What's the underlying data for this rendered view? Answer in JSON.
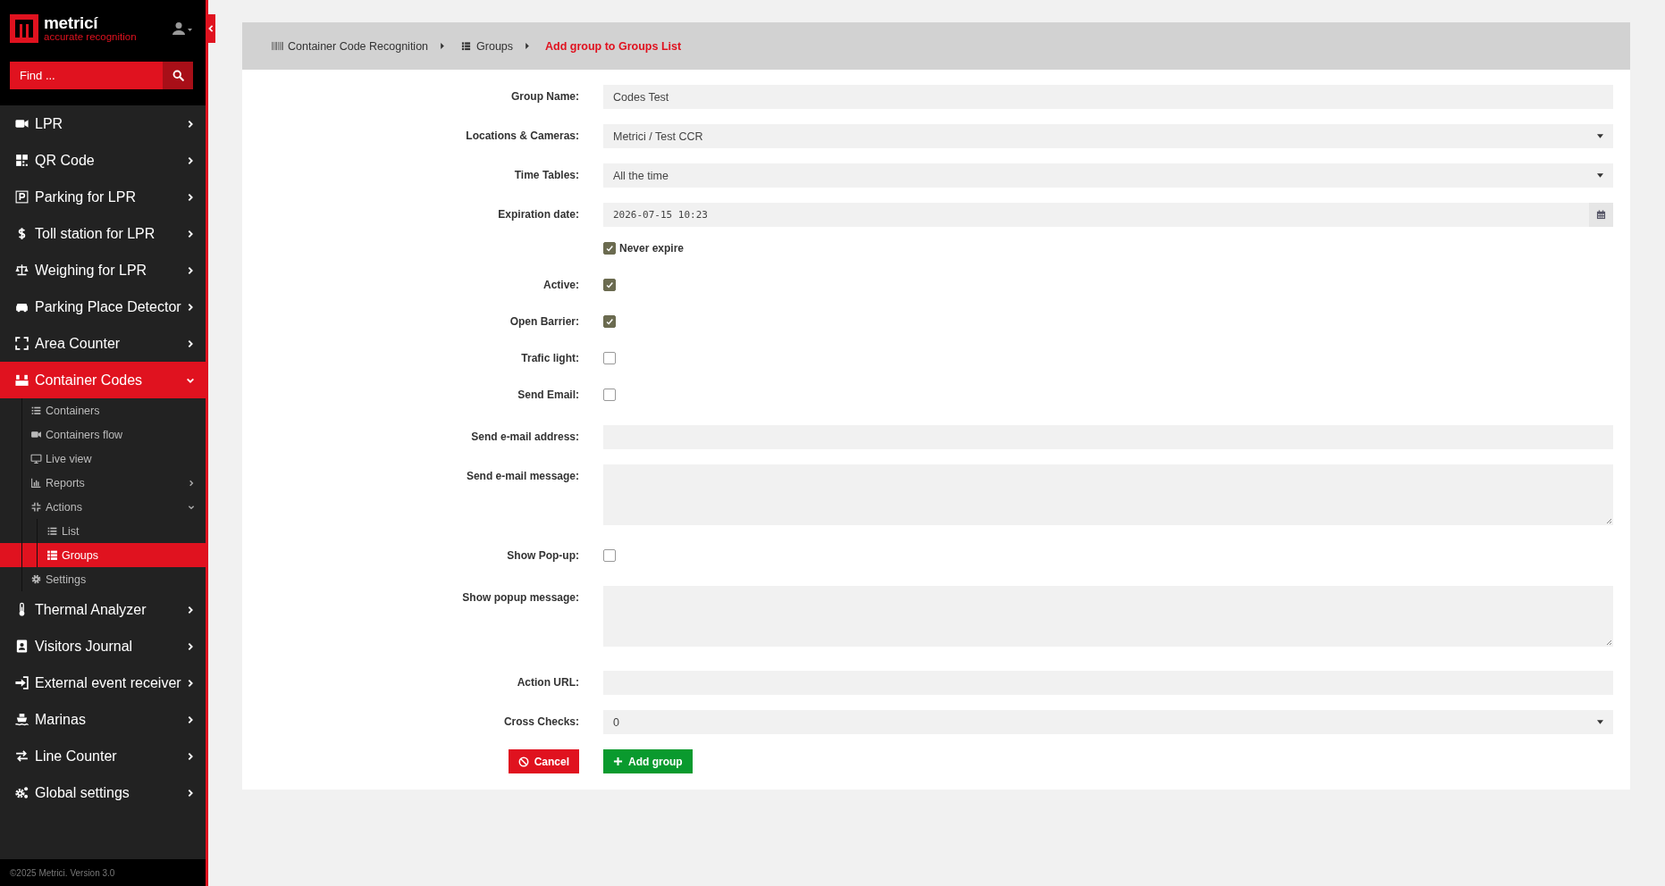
{
  "sidebar": {
    "logo": {
      "name": "metricí",
      "tagline": "accurate recognition"
    },
    "search": {
      "placeholder": "Find ..."
    },
    "menu": [
      {
        "label": "LPR",
        "expanded": false,
        "selected": false
      },
      {
        "label": "QR Code",
        "expanded": false,
        "selected": false
      },
      {
        "label": "Parking for LPR",
        "expanded": false,
        "selected": false
      },
      {
        "label": "Toll station for LPR",
        "expanded": false,
        "selected": false
      },
      {
        "label": "Weighing for LPR",
        "expanded": false,
        "selected": false
      },
      {
        "label": "Parking Place Detector",
        "expanded": false,
        "selected": false
      },
      {
        "label": "Area Counter",
        "expanded": false,
        "selected": false
      },
      {
        "label": "Container Codes",
        "expanded": true,
        "selected": true,
        "children": [
          {
            "label": "Containers",
            "selected": false
          },
          {
            "label": "Containers flow",
            "selected": false
          },
          {
            "label": "Live view",
            "selected": false
          },
          {
            "label": "Reports",
            "expanded": false,
            "selected": false
          },
          {
            "label": "Actions",
            "expanded": true,
            "selected": false,
            "children": [
              {
                "label": "List",
                "selected": false
              },
              {
                "label": "Groups",
                "selected": true
              }
            ]
          },
          {
            "label": "Settings",
            "selected": false
          }
        ]
      },
      {
        "label": "Thermal Analyzer",
        "expanded": false,
        "selected": false
      },
      {
        "label": "Visitors Journal",
        "expanded": false,
        "selected": false
      },
      {
        "label": "External event receiver",
        "expanded": false,
        "selected": false
      },
      {
        "label": "Marinas",
        "expanded": false,
        "selected": false
      },
      {
        "label": "Line Counter",
        "expanded": false,
        "selected": false
      },
      {
        "label": "Global settings",
        "expanded": false,
        "selected": false
      }
    ],
    "footer": "©2025 Metrici. Version 3.0"
  },
  "breadcrumb": [
    {
      "label": "Container Code Recognition",
      "current": false
    },
    {
      "label": "Groups",
      "current": false
    },
    {
      "label": "Add group to Groups List",
      "current": true
    }
  ],
  "form": {
    "fields": [
      {
        "kind": "text",
        "label": "Group Name:",
        "value": "Codes Test"
      },
      {
        "kind": "select",
        "label": "Locations & Cameras:",
        "value": "Metrici / Test CCR"
      },
      {
        "kind": "select",
        "label": "Time Tables:",
        "value": "All the time"
      },
      {
        "kind": "date",
        "label": "Expiration date:",
        "value": "2026-07-15 10:23"
      },
      {
        "kind": "inline_checkbox",
        "label": "Never expire",
        "checked": true
      },
      {
        "kind": "checkbox",
        "label": "Active:",
        "checked": true
      },
      {
        "kind": "checkbox",
        "label": "Open Barrier:",
        "checked": true
      },
      {
        "kind": "checkbox",
        "label": "Trafic light:",
        "checked": false
      },
      {
        "kind": "checkbox",
        "label": "Send Email:",
        "checked": false
      },
      {
        "kind": "text",
        "label": "Send e-mail address:"
      },
      {
        "kind": "textarea",
        "label": "Send e-mail message:"
      },
      {
        "kind": "checkbox",
        "label": "Show Pop-up:",
        "checked": false
      },
      {
        "kind": "textarea",
        "label": "Show popup message:"
      },
      {
        "kind": "text",
        "label": "Action URL:"
      },
      {
        "kind": "select",
        "label": "Cross Checks:",
        "value": "0"
      }
    ],
    "buttons": [
      {
        "kind": "cancel",
        "label": "Cancel"
      },
      {
        "kind": "submit",
        "label": "Add group"
      }
    ]
  }
}
